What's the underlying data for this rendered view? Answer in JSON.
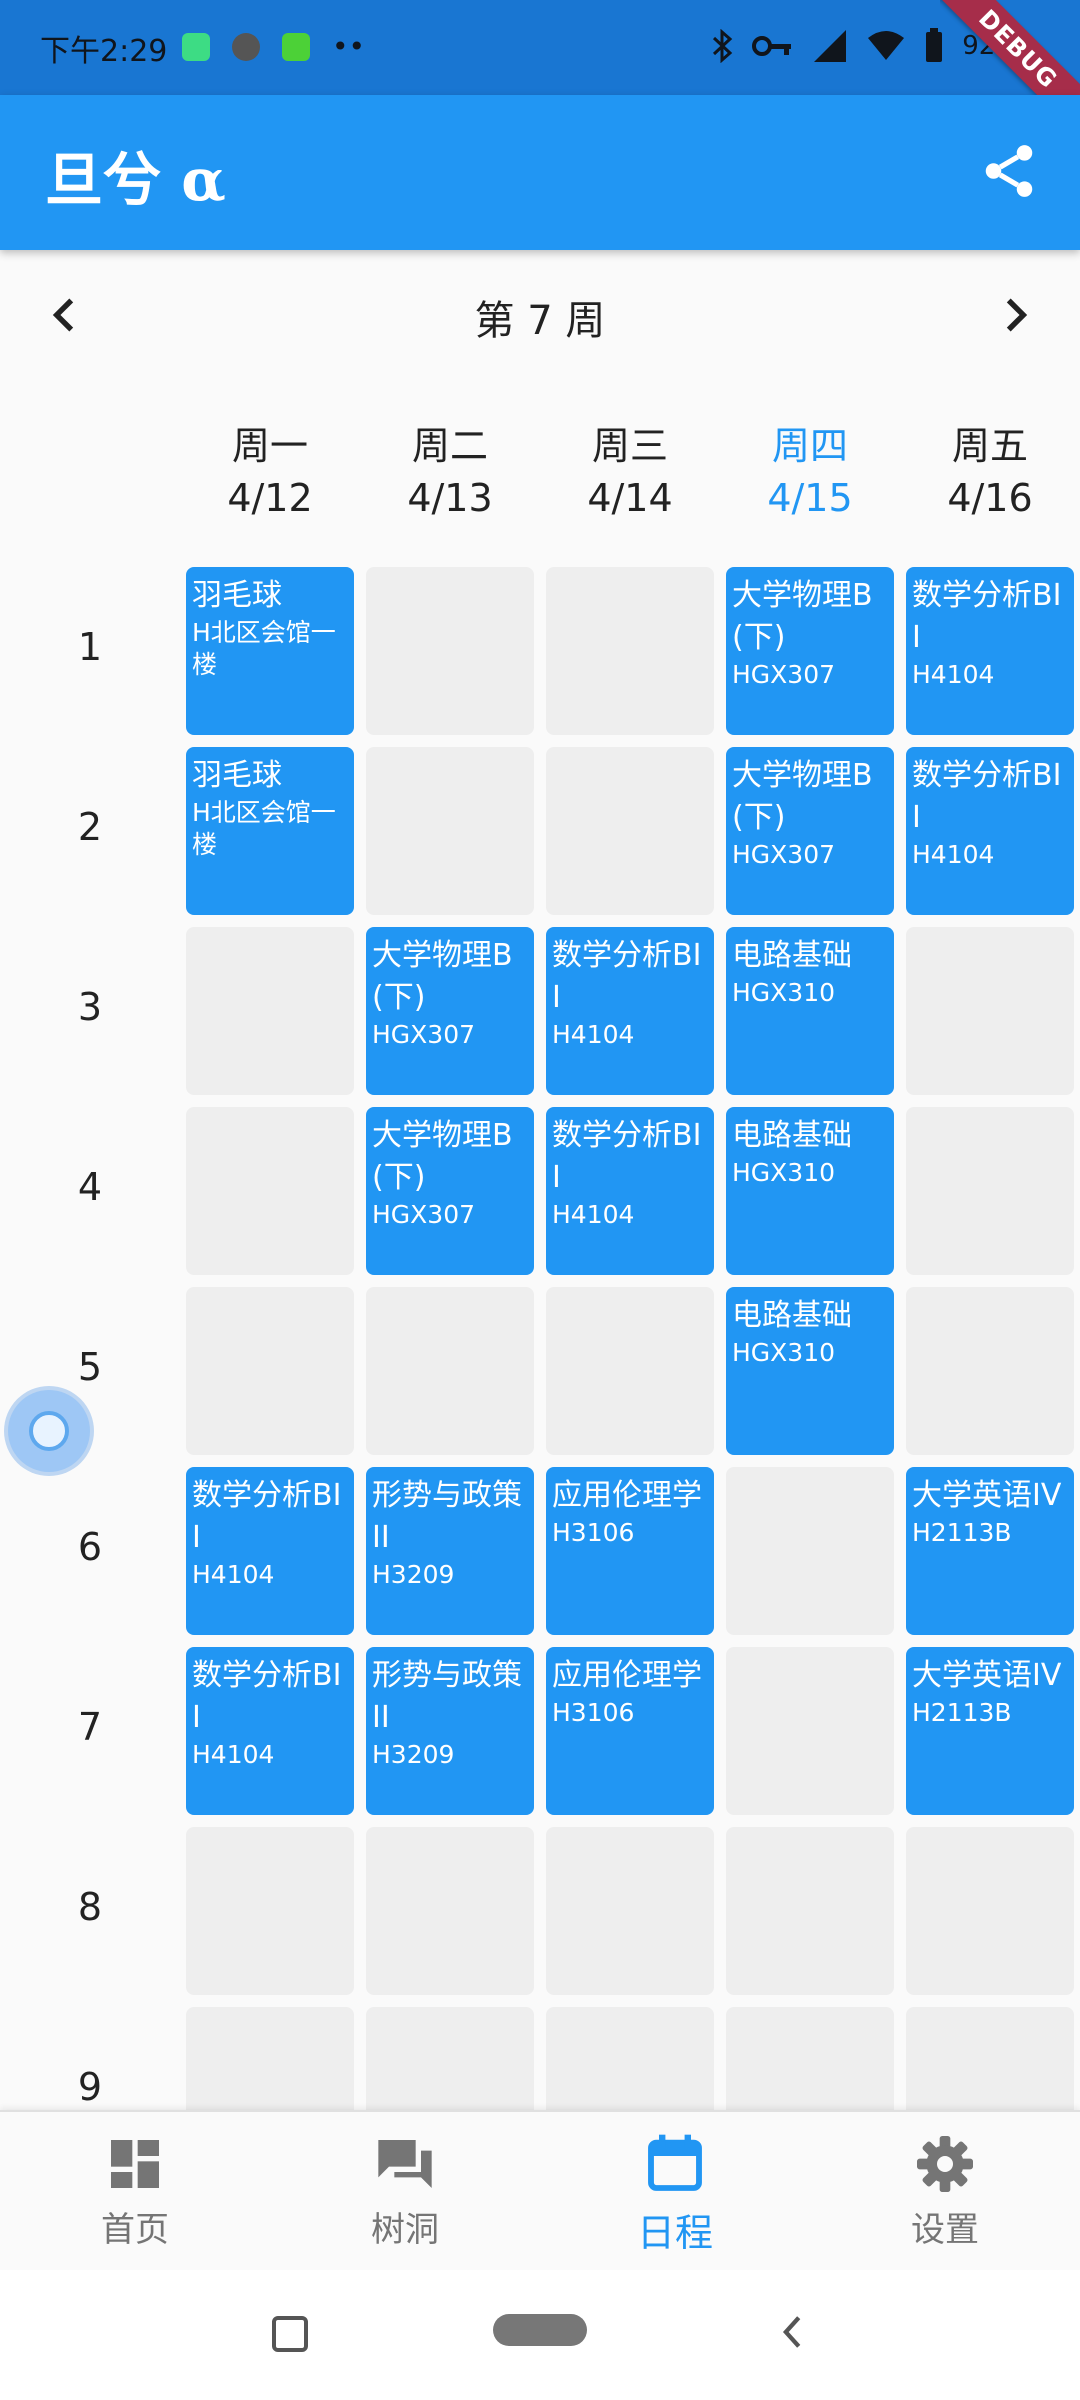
{
  "status_bar": {
    "time": "下午2:29",
    "battery": "92%",
    "debug_banner": "DEBUG"
  },
  "app_bar": {
    "title": "旦兮 α"
  },
  "week_nav": {
    "label": "第 7 周"
  },
  "days": [
    {
      "name": "周一",
      "date": "4/12",
      "today": false
    },
    {
      "name": "周二",
      "date": "4/13",
      "today": false
    },
    {
      "name": "周三",
      "date": "4/14",
      "today": false
    },
    {
      "name": "周四",
      "date": "4/15",
      "today": true
    },
    {
      "name": "周五",
      "date": "4/16",
      "today": false
    }
  ],
  "periods": [
    "1",
    "2",
    "3",
    "4",
    "5",
    "6",
    "7",
    "8",
    "9"
  ],
  "timetable": [
    [
      {
        "name": "羽毛球",
        "room": "H北区会馆一楼"
      },
      {},
      {},
      {
        "name": "大学物理B(下)",
        "room": "HGX307"
      },
      {
        "name": "数学分析BII",
        "room": "H4104"
      }
    ],
    [
      {
        "name": "羽毛球",
        "room": "H北区会馆一楼"
      },
      {},
      {},
      {
        "name": "大学物理B(下)",
        "room": "HGX307"
      },
      {
        "name": "数学分析BII",
        "room": "H4104"
      }
    ],
    [
      {},
      {
        "name": "大学物理B(下)",
        "room": "HGX307"
      },
      {
        "name": "数学分析BII",
        "room": "H4104"
      },
      {
        "name": "电路基础",
        "room": "HGX310"
      },
      {}
    ],
    [
      {},
      {
        "name": "大学物理B(下)",
        "room": "HGX307"
      },
      {
        "name": "数学分析BII",
        "room": "H4104"
      },
      {
        "name": "电路基础",
        "room": "HGX310"
      },
      {}
    ],
    [
      {},
      {},
      {},
      {
        "name": "电路基础",
        "room": "HGX310"
      },
      {}
    ],
    [
      {
        "name": "数学分析BII",
        "room": "H4104"
      },
      {
        "name": "形势与政策II",
        "room": "H3209"
      },
      {
        "name": "应用伦理学",
        "room": "H3106"
      },
      {},
      {
        "name": "大学英语IV",
        "room": "H2113B"
      }
    ],
    [
      {
        "name": "数学分析BII",
        "room": "H4104"
      },
      {
        "name": "形势与政策II",
        "room": "H3209"
      },
      {
        "name": "应用伦理学",
        "room": "H3106"
      },
      {},
      {
        "name": "大学英语IV",
        "room": "H2113B"
      }
    ],
    [
      {},
      {},
      {},
      {},
      {}
    ],
    [
      {},
      {},
      {},
      {},
      {}
    ]
  ],
  "bottom_nav": [
    {
      "label": "首页",
      "icon": "dashboard-icon",
      "active": false
    },
    {
      "label": "树洞",
      "icon": "forum-icon",
      "active": false
    },
    {
      "label": "日程",
      "icon": "calendar-icon",
      "active": true
    },
    {
      "label": "设置",
      "icon": "gear-icon",
      "active": false
    }
  ],
  "colors": {
    "primary": "#2196f3",
    "status_bar": "#1976d2",
    "empty_cell": "#eeeeee"
  }
}
